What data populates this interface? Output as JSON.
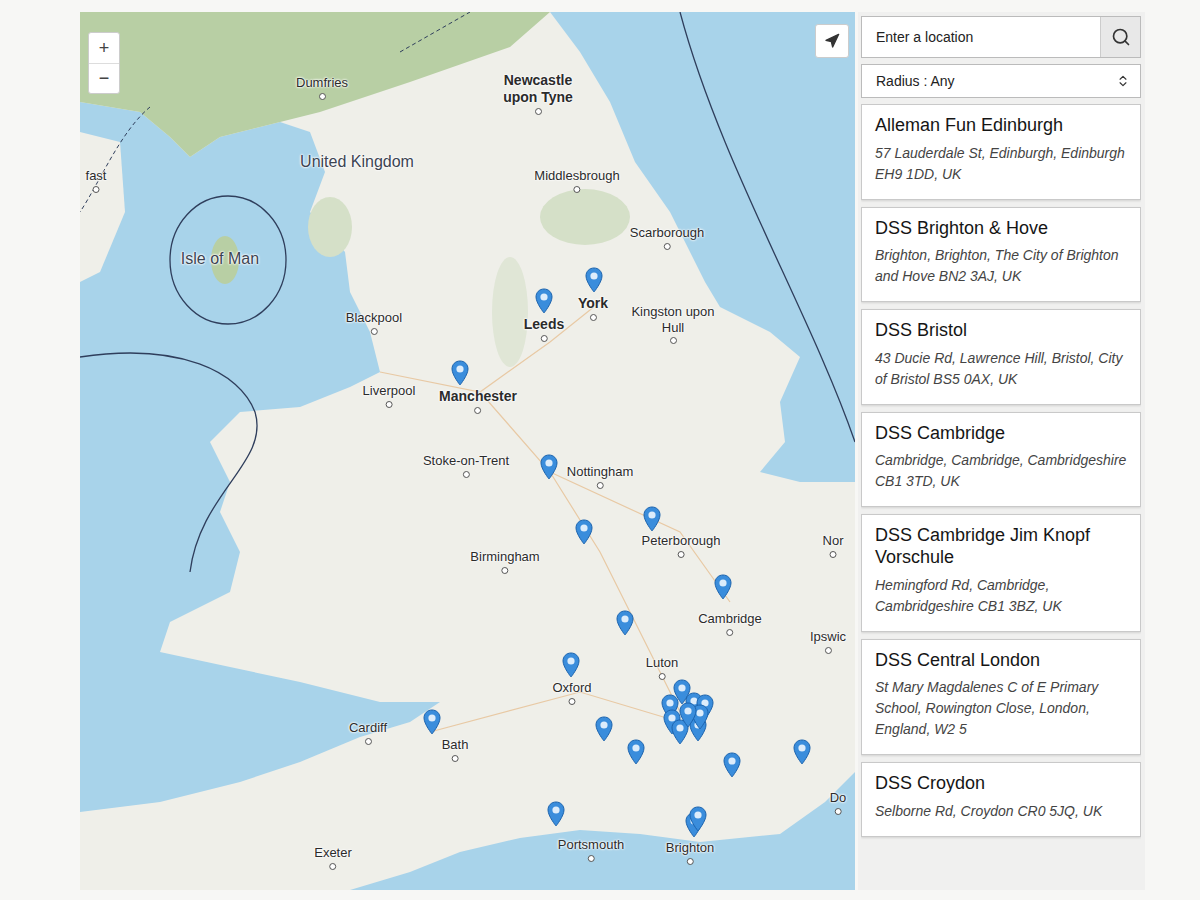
{
  "map": {
    "zoom_in": "+",
    "zoom_out": "−",
    "labels": [
      {
        "name": "Dumfries",
        "kind": "city"
      },
      {
        "name": "Newcastle upon Tyne",
        "kind": "major"
      },
      {
        "name": "United Kingdom",
        "kind": "region"
      },
      {
        "name": "Middlesbrough",
        "kind": "city"
      },
      {
        "name": "Scarborough",
        "kind": "city"
      },
      {
        "name": "Isle of Man",
        "kind": "region"
      },
      {
        "name": "York",
        "kind": "major"
      },
      {
        "name": "Kingston upon Hull",
        "kind": "city"
      },
      {
        "name": "Leeds",
        "kind": "major"
      },
      {
        "name": "Blackpool",
        "kind": "city"
      },
      {
        "name": "Manchester",
        "kind": "major"
      },
      {
        "name": "Liverpool",
        "kind": "city"
      },
      {
        "name": "Stoke-on-Trent",
        "kind": "city"
      },
      {
        "name": "Nottingham",
        "kind": "city"
      },
      {
        "name": "Birmingham",
        "kind": "city"
      },
      {
        "name": "Peterborough",
        "kind": "city"
      },
      {
        "name": "Nor",
        "kind": "city"
      },
      {
        "name": "Cambridge",
        "kind": "city"
      },
      {
        "name": "Ipswic",
        "kind": "city"
      },
      {
        "name": "Luton",
        "kind": "city"
      },
      {
        "name": "Oxford",
        "kind": "city"
      },
      {
        "name": "Cardiff",
        "kind": "city"
      },
      {
        "name": "Bath",
        "kind": "city"
      },
      {
        "name": "Portsmouth",
        "kind": "city"
      },
      {
        "name": "Brighton",
        "kind": "city"
      },
      {
        "name": "Exeter",
        "kind": "city"
      },
      {
        "name": "fast",
        "kind": "city"
      },
      {
        "name": "Do",
        "kind": "city"
      }
    ]
  },
  "search": {
    "placeholder": "Enter a location"
  },
  "radius": {
    "value": "Radius : Any"
  },
  "schools": [
    {
      "name": "Alleman Fun Edinburgh",
      "address": "57 Lauderdale St, Edinburgh, Edinburgh EH9 1DD, UK"
    },
    {
      "name": "DSS Brighton & Hove",
      "address": "Brighton, Brighton, The City of Brighton and Hove BN2 3AJ, UK"
    },
    {
      "name": "DSS Bristol",
      "address": "43 Ducie Rd, Lawrence Hill, Bristol, City of Bristol BS5 0AX, UK"
    },
    {
      "name": "DSS Cambridge",
      "address": "Cambridge, Cambridge, Cambridgeshire CB1 3TD, UK"
    },
    {
      "name": "DSS Cambridge Jim Knopf Vorschule",
      "address": "Hemingford Rd, Cambridge, Cambridgeshire CB1 3BZ, UK"
    },
    {
      "name": "DSS Central London",
      "address": "St Mary Magdalenes C of E Primary School, Rowington Close, London, England, W2 5"
    },
    {
      "name": "DSS Croydon",
      "address": "Selborne Rd, Croydon CR0 5JQ, UK"
    }
  ]
}
